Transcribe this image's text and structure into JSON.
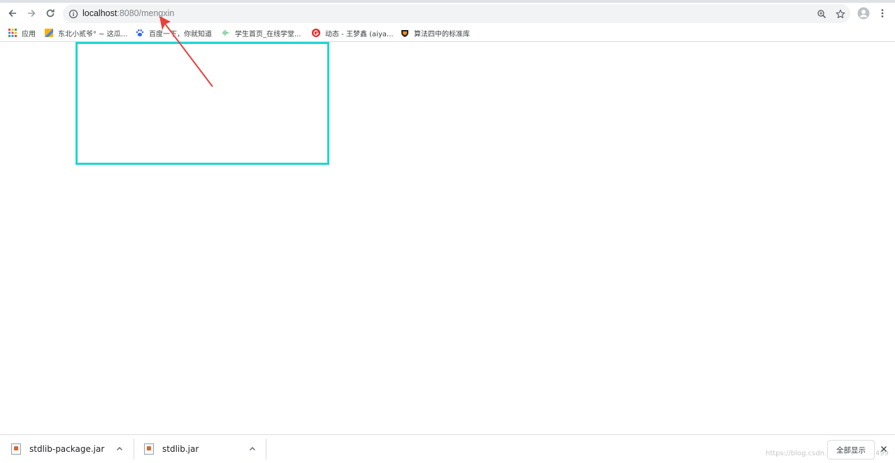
{
  "browser": {
    "url_host": "localhost",
    "url_rest": ":8080/mengxin",
    "icons": [
      "back-arrow-icon",
      "forward-arrow-icon",
      "reload-icon",
      "info-icon",
      "zoom-icon",
      "star-icon",
      "profile-icon",
      "more-icon"
    ]
  },
  "bookmarks": {
    "apps_label": "应用",
    "items": [
      {
        "label": "东北小贰爷° ~ 这瓜...",
        "icon": "yellow-square-icon"
      },
      {
        "label": "百度一下，你就知道",
        "icon": "baidu-paw-icon"
      },
      {
        "label": "学生首页_在线学堂...",
        "icon": "wave-icon"
      },
      {
        "label": "动态 - 王梦鑫 (aiya...",
        "icon": "red-g-icon"
      },
      {
        "label": "算法四中的标准库",
        "icon": "crest-icon"
      }
    ]
  },
  "downloads": {
    "items": [
      {
        "name": "stdlib-package.jar"
      },
      {
        "name": "stdlib.jar"
      }
    ],
    "show_all_label": "全部显示",
    "watermark": "https://blog.csdn.net/weixin_43499"
  },
  "colors": {
    "highlight": "#1fd6d6",
    "arrow": "#e8413a",
    "omnibox_bg": "#f1f3f4"
  }
}
